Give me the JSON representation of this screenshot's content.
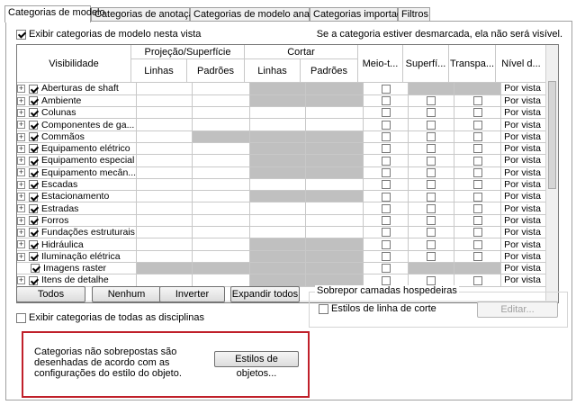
{
  "tabs": [
    {
      "label": "Categorias de modelo",
      "active": true
    },
    {
      "label": "Categorias de anotação",
      "active": false
    },
    {
      "label": "Categorias de modelo analítico",
      "active": false
    },
    {
      "label": "Categorias importadas",
      "active": false
    },
    {
      "label": "Filtros",
      "active": false
    }
  ],
  "show_model_categories": {
    "label": "Exibir categorias de modelo nesta vista",
    "checked": true
  },
  "note": "Se a categoria estiver desmarcada, ela não será visível.",
  "grid": {
    "headers": {
      "visibility": "Visibilidade",
      "projection": "Projeção/Superfície",
      "cut": "Cortar",
      "lines": "Linhas",
      "patterns": "Padrões",
      "halftone": "Meio-t...",
      "surface": "Superfí...",
      "transparency": "Transpa...",
      "detail_level": "Nível d..."
    },
    "rows": [
      {
        "name": "Aberturas de shaft",
        "expand": true,
        "checked": true,
        "proj_lines_gray": false,
        "proj_pat_gray": false,
        "cut_gray": true,
        "halftone_cb": true,
        "surface_gray": true,
        "transp_gray": true,
        "level": "Por vista"
      },
      {
        "name": "Ambiente",
        "expand": true,
        "checked": true,
        "proj_lines_gray": false,
        "proj_pat_gray": false,
        "cut_gray": true,
        "halftone_cb": true,
        "surface_gray": false,
        "transp_gray": false,
        "level": "Por vista"
      },
      {
        "name": "Colunas",
        "expand": true,
        "checked": true,
        "proj_lines_gray": false,
        "proj_pat_gray": false,
        "cut_gray": false,
        "halftone_cb": true,
        "surface_gray": false,
        "transp_gray": false,
        "level": "Por vista"
      },
      {
        "name": "Componentes de ga...",
        "expand": true,
        "checked": true,
        "proj_lines_gray": false,
        "proj_pat_gray": false,
        "cut_gray": false,
        "halftone_cb": true,
        "surface_gray": false,
        "transp_gray": false,
        "level": "Por vista"
      },
      {
        "name": "Commãos",
        "expand": true,
        "checked": true,
        "proj_lines_gray": false,
        "proj_pat_gray": true,
        "cut_gray": true,
        "halftone_cb": true,
        "surface_gray": false,
        "transp_gray": false,
        "level": "Por vista"
      },
      {
        "name": "Equipamento elétrico",
        "expand": true,
        "checked": true,
        "proj_lines_gray": false,
        "proj_pat_gray": false,
        "cut_gray": true,
        "halftone_cb": true,
        "surface_gray": false,
        "transp_gray": false,
        "level": "Por vista"
      },
      {
        "name": "Equipamento especial",
        "expand": true,
        "checked": true,
        "proj_lines_gray": false,
        "proj_pat_gray": false,
        "cut_gray": true,
        "halftone_cb": true,
        "surface_gray": false,
        "transp_gray": false,
        "level": "Por vista"
      },
      {
        "name": "Equipamento mecân...",
        "expand": true,
        "checked": true,
        "proj_lines_gray": false,
        "proj_pat_gray": false,
        "cut_gray": true,
        "halftone_cb": true,
        "surface_gray": false,
        "transp_gray": false,
        "level": "Por vista"
      },
      {
        "name": "Escadas",
        "expand": true,
        "checked": true,
        "proj_lines_gray": false,
        "proj_pat_gray": false,
        "cut_gray": false,
        "halftone_cb": true,
        "surface_gray": false,
        "transp_gray": false,
        "level": "Por vista"
      },
      {
        "name": "Estacionamento",
        "expand": true,
        "checked": true,
        "proj_lines_gray": false,
        "proj_pat_gray": false,
        "cut_gray": true,
        "halftone_cb": true,
        "surface_gray": false,
        "transp_gray": false,
        "level": "Por vista"
      },
      {
        "name": "Estradas",
        "expand": true,
        "checked": true,
        "proj_lines_gray": false,
        "proj_pat_gray": false,
        "cut_gray": false,
        "halftone_cb": true,
        "surface_gray": false,
        "transp_gray": false,
        "level": "Por vista"
      },
      {
        "name": "Forros",
        "expand": true,
        "checked": true,
        "proj_lines_gray": false,
        "proj_pat_gray": false,
        "cut_gray": false,
        "halftone_cb": true,
        "surface_gray": false,
        "transp_gray": false,
        "level": "Por vista"
      },
      {
        "name": "Fundações estruturais",
        "expand": true,
        "checked": true,
        "proj_lines_gray": false,
        "proj_pat_gray": false,
        "cut_gray": false,
        "halftone_cb": true,
        "surface_gray": false,
        "transp_gray": false,
        "level": "Por vista"
      },
      {
        "name": "Hidráulica",
        "expand": true,
        "checked": true,
        "proj_lines_gray": false,
        "proj_pat_gray": false,
        "cut_gray": true,
        "halftone_cb": true,
        "surface_gray": false,
        "transp_gray": false,
        "level": "Por vista"
      },
      {
        "name": "Iluminação elétrica",
        "expand": true,
        "checked": true,
        "proj_lines_gray": false,
        "proj_pat_gray": false,
        "cut_gray": true,
        "halftone_cb": true,
        "surface_gray": false,
        "transp_gray": false,
        "level": "Por vista"
      },
      {
        "name": "Imagens raster",
        "expand": false,
        "checked": true,
        "proj_lines_gray": true,
        "proj_pat_gray": true,
        "cut_gray": true,
        "halftone_cb": true,
        "surface_gray": true,
        "transp_gray": true,
        "level": "Por vista"
      },
      {
        "name": "Itens de detalhe",
        "expand": true,
        "checked": true,
        "proj_lines_gray": false,
        "proj_pat_gray": false,
        "cut_gray": true,
        "halftone_cb": true,
        "surface_gray": false,
        "transp_gray": false,
        "level": "Por vista"
      }
    ]
  },
  "buttons": {
    "all": "Todos",
    "none": "Nenhum",
    "invert": "Inverter",
    "expand_all": "Expandir todos"
  },
  "show_all_disciplines": {
    "label": "Exibir categorias de todas as disciplinas",
    "checked": false
  },
  "host_layers": {
    "legend": "Sobrepor camadas hospedeiras",
    "cut_line_styles": {
      "label": "Estilos de linha de corte",
      "checked": false
    },
    "edit": "Editar..."
  },
  "info": {
    "text": "Categorias não sobrepostas são desenhadas de acordo com as configurações do estilo do objeto.",
    "button": "Estilos de objetos..."
  }
}
